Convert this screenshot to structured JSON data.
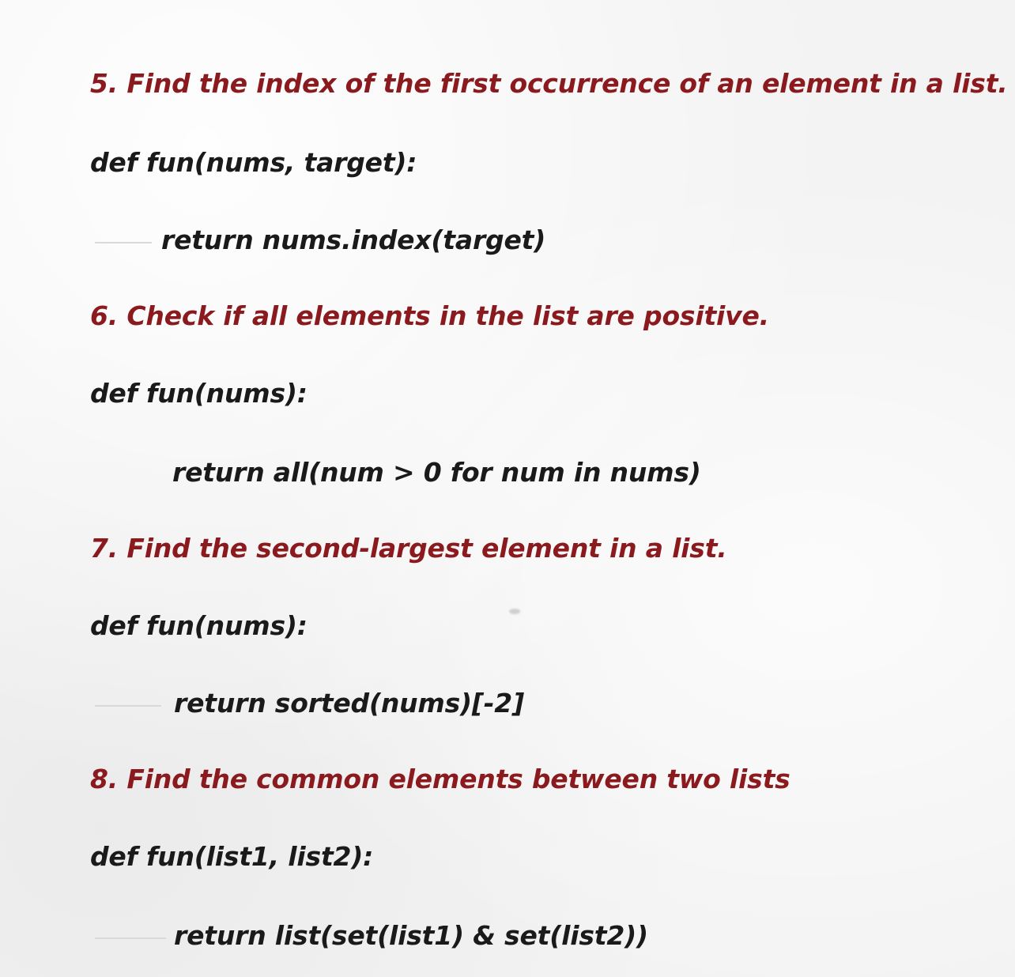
{
  "colors": {
    "heading": "#8b1a1f",
    "code": "#1a1a1a",
    "background": "#f3f3f3"
  },
  "sections": [
    {
      "heading": "5. Find the index of the first occurrence of an element in a list.",
      "def_line": "def fun(nums, target):",
      "return_line": "return nums.index(target)"
    },
    {
      "heading": "6. Check if all elements in the list are positive.",
      "def_line": "def fun(nums):",
      "return_line": "return all(num > 0 for num in nums)"
    },
    {
      "heading": "7. Find the second-largest element in a list.",
      "def_line": "def fun(nums):",
      "return_line": "return sorted(nums)[-2]"
    },
    {
      "heading": "8. Find the common elements between two lists",
      "def_line": "def fun(list1, list2):",
      "return_line": "return list(set(list1) & set(list2))"
    }
  ]
}
